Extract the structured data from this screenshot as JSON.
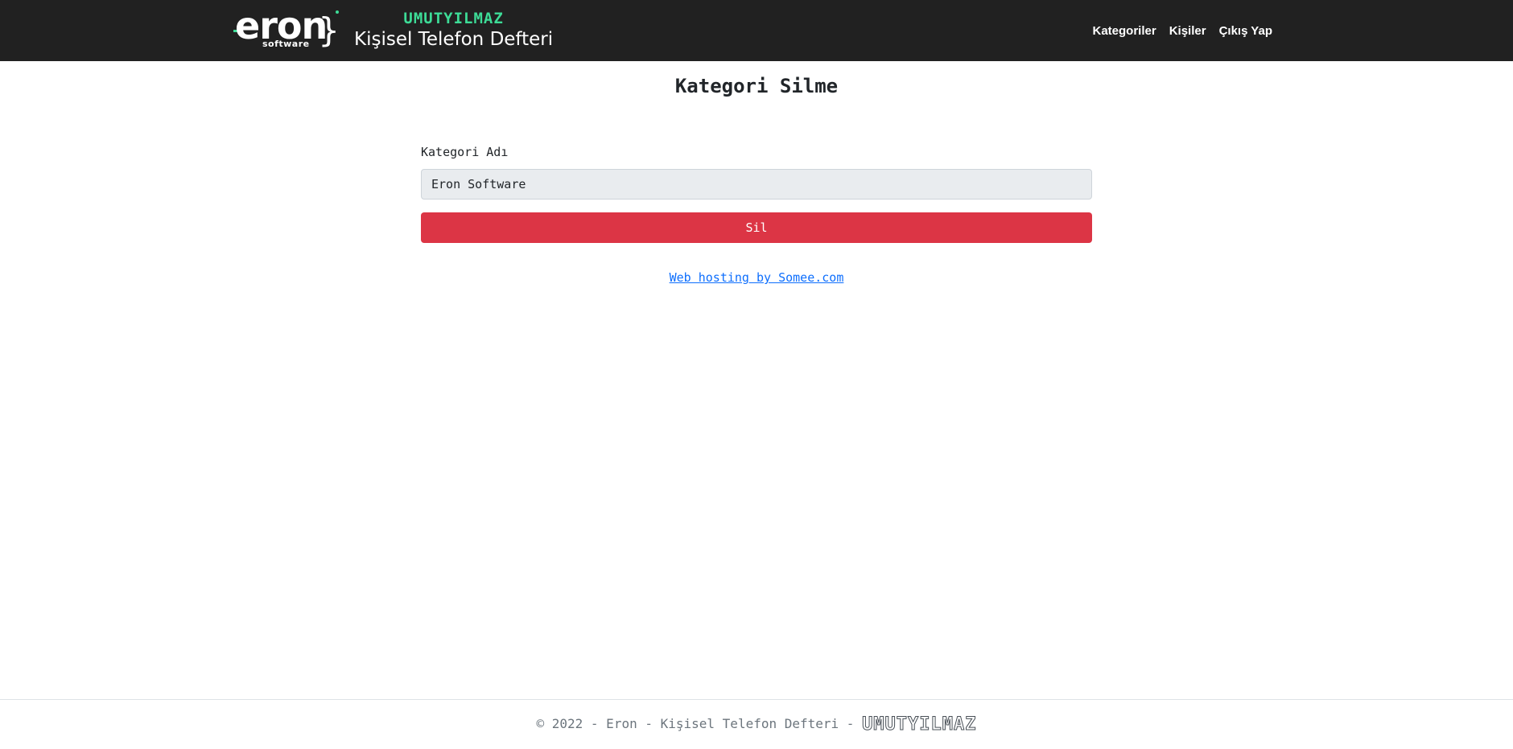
{
  "brand": {
    "logo_word": "eron",
    "logo_sub": "software",
    "author": "UMUTYILMAZ",
    "title": "Kişisel Telefon Defteri"
  },
  "nav": {
    "items": [
      {
        "label": "Kategoriler"
      },
      {
        "label": "Kişiler"
      },
      {
        "label": "Çıkış Yap"
      }
    ]
  },
  "main": {
    "title": "Kategori Silme",
    "field_label": "Kategori Adı",
    "field_value": "Eron Software",
    "delete_button": "Sil",
    "hosting_link": "Web hosting by Somee.com"
  },
  "footer": {
    "text": "© 2022 - Eron - Kişisel Telefon Defteri - ",
    "author": "UMUTYILMAZ"
  },
  "colors": {
    "navbar_bg": "#212121",
    "accent_green": "#3ddc97",
    "danger": "#dc3545",
    "link": "#0d6efd"
  }
}
